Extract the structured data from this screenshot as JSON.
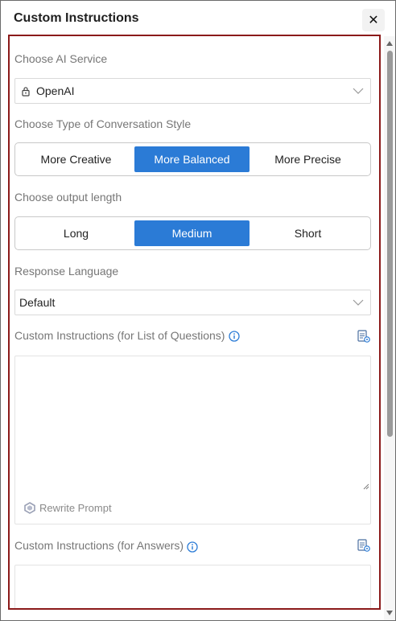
{
  "dialog": {
    "title": "Custom Instructions",
    "close_label": "✕"
  },
  "ai_service": {
    "label": "Choose AI Service",
    "selected": "OpenAI",
    "icon": "lock-icon"
  },
  "conversation_style": {
    "label": "Choose Type of Conversation Style",
    "options": [
      "More Creative",
      "More Balanced",
      "More Precise"
    ],
    "selected": "More Balanced"
  },
  "output_length": {
    "label": "Choose output length",
    "options": [
      "Long",
      "Medium",
      "Short"
    ],
    "selected": "Medium"
  },
  "response_language": {
    "label": "Response Language",
    "selected": "Default"
  },
  "questions_instructions": {
    "label": "Custom Instructions (for List of Questions)",
    "value": "",
    "rewrite_label": "Rewrite Prompt"
  },
  "answers_instructions": {
    "label": "Custom Instructions (for Answers)",
    "value": ""
  },
  "colors": {
    "accent": "#2b7bd6",
    "frame_border": "#8b1a1a"
  }
}
